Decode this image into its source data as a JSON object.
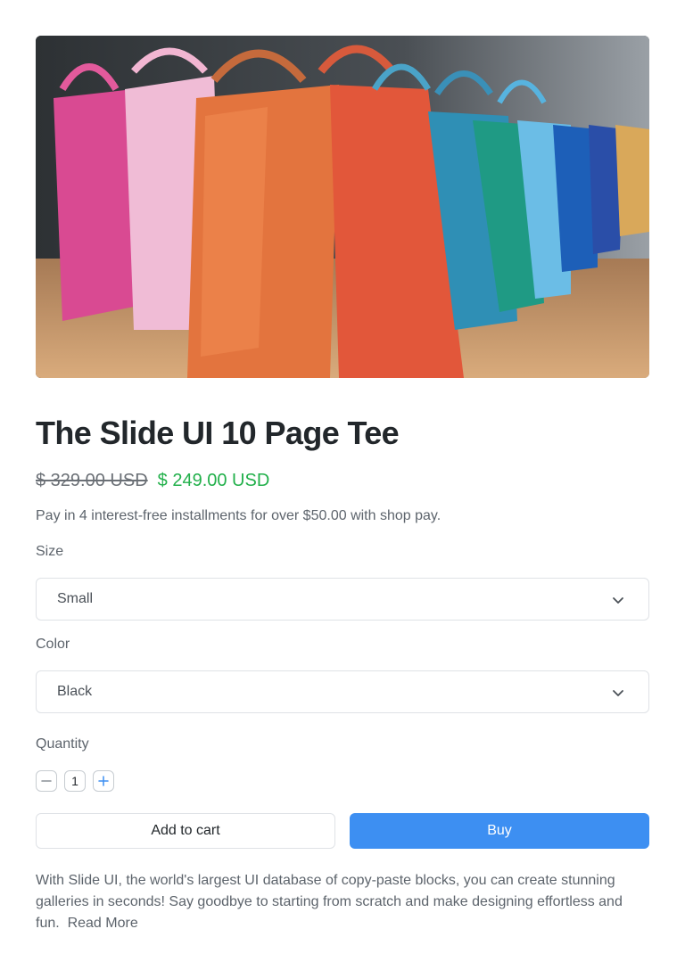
{
  "product": {
    "title": "The Slide UI 10 Page Tee",
    "old_price": "$ 329.00 USD",
    "new_price": "$ 249.00 USD",
    "installments": "Pay in 4 interest-free installments for over $50.00 with shop pay."
  },
  "size": {
    "label": "Size",
    "value": "Small"
  },
  "color": {
    "label": "Color",
    "value": "Black"
  },
  "quantity": {
    "label": "Quantity",
    "value": "1"
  },
  "actions": {
    "add_to_cart": "Add to cart",
    "buy": "Buy"
  },
  "description": {
    "text": "With Slide UI, the world's largest UI database of copy-paste blocks, you can create stunning galleries in seconds! Say goodbye to starting from scratch and make designing effortless and fun.",
    "read_more": "Read More"
  },
  "colors": {
    "accent": "#3d8ff2",
    "sale_price": "#22b04b"
  }
}
